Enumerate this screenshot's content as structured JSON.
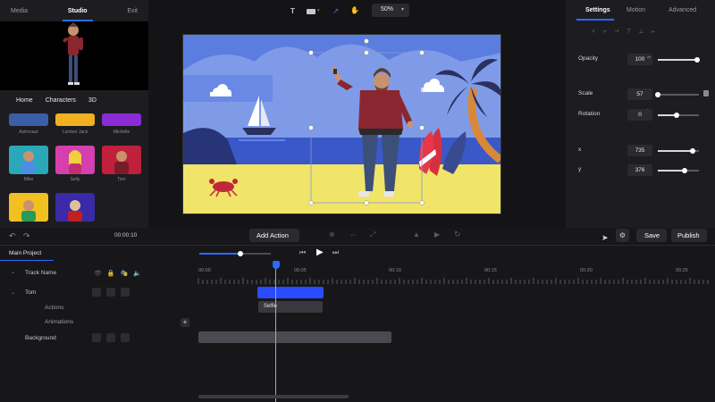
{
  "left_tabs": {
    "media": "Media",
    "studio": "Studio",
    "exit": "Exit"
  },
  "sub_tabs": [
    "Home",
    "Characters",
    "3D"
  ],
  "characters": [
    {
      "name": "Astronaut"
    },
    {
      "name": "Lumber Jack"
    },
    {
      "name": "Michelle"
    },
    {
      "name": "Mike"
    },
    {
      "name": "Selly"
    },
    {
      "name": "Tom"
    },
    {
      "name": ""
    },
    {
      "name": ""
    }
  ],
  "playback_time": "00:00:10",
  "top_toolbar": {
    "zoom": "50%"
  },
  "right_tabs": {
    "settings": "Settings",
    "motion": "Motion",
    "advanced": "Advanced"
  },
  "properties": {
    "opacity": {
      "label": "Opacity",
      "value": "100",
      "fraction": 1.0
    },
    "scale": {
      "label": "Scale",
      "value": "57",
      "fraction": 0.0
    },
    "rotation": {
      "label": "Rotation",
      "value": "0",
      "fraction": 0.45
    },
    "x": {
      "label": "x",
      "value": "735",
      "fraction": 0.85
    },
    "y": {
      "label": "y",
      "value": "376",
      "fraction": 0.65
    }
  },
  "actions": {
    "add_action": "Add Action",
    "save": "Save",
    "publish": "Publish"
  },
  "timeline": {
    "project": "Main Project",
    "tracks": {
      "track_name": "Track Name",
      "tom": "Tom",
      "actions": "Actions",
      "animations": "Animations",
      "background": "Background"
    },
    "ruler": [
      "00:00",
      "00:05",
      "00:10",
      "00:15",
      "00:20",
      "00:25"
    ],
    "clip_label": "Selfie"
  },
  "colors": {
    "accent": "#2b6bff",
    "sky": "#5b7de0",
    "sand": "#f0e469"
  }
}
